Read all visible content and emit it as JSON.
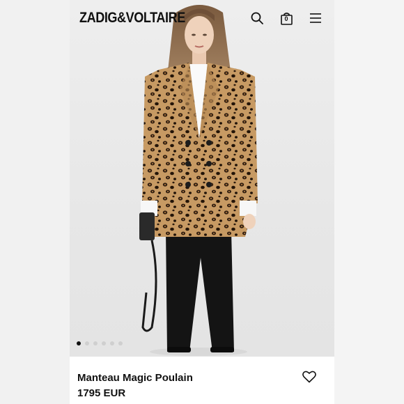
{
  "brand": {
    "logo": "ZADIG&VOLTAIRE"
  },
  "header": {
    "icons": [
      "search-icon",
      "bag-icon",
      "menu-icon"
    ],
    "bag_count": "0"
  },
  "carousel": {
    "total_slides": 6,
    "active_index": 0
  },
  "product": {
    "name": "Manteau Magic Poulain",
    "price": "1795 EUR"
  },
  "colors": {
    "text": "#111111",
    "dot_inactive": "#cfcfcf"
  }
}
